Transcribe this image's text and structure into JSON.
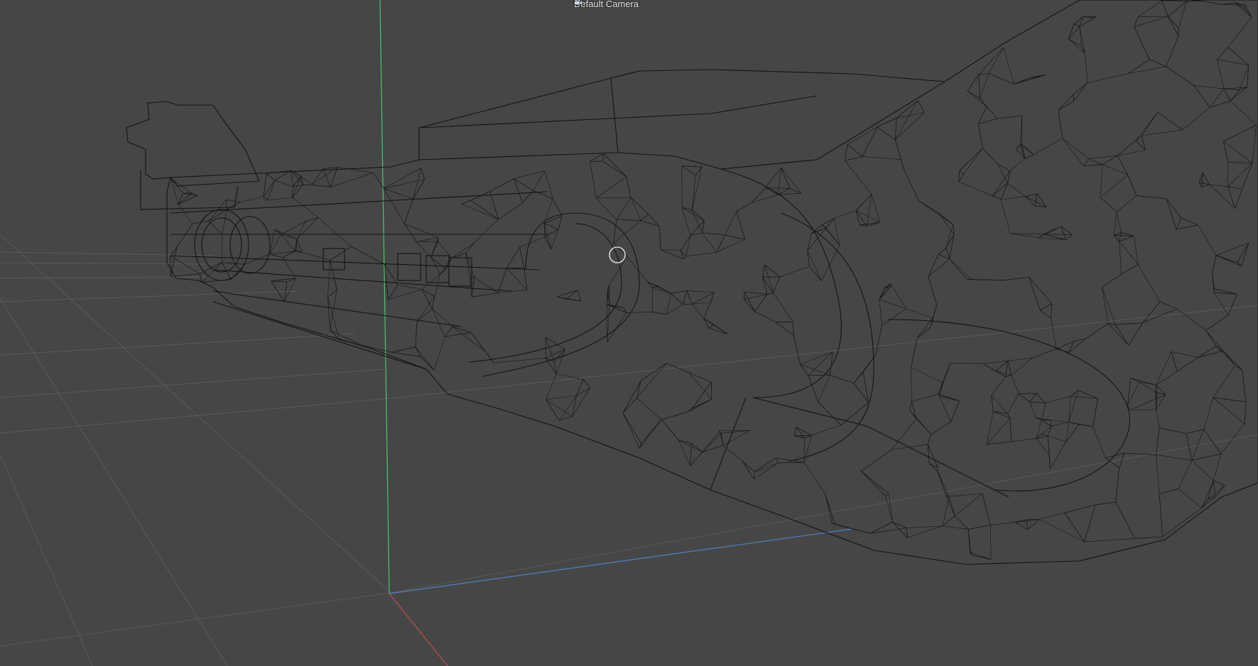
{
  "viewport": {
    "camera_label": "Default Camera",
    "camera_icon": "camera-icon",
    "background_color": "#464646",
    "axis_colors": {
      "y": "#49c86c",
      "x": "#c0504d",
      "z": "#4e7fc9"
    },
    "wire_color": "#141414"
  }
}
